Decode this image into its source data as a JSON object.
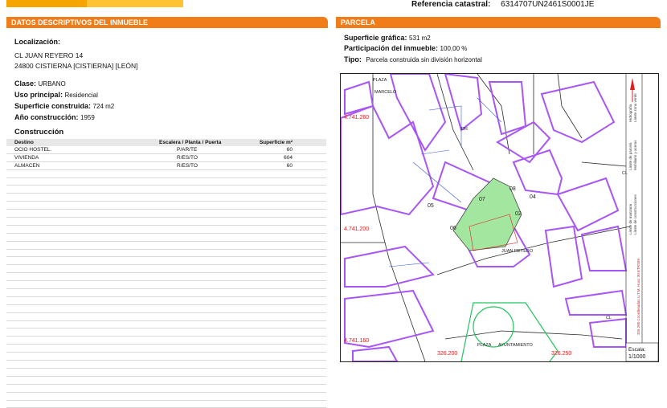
{
  "header": {
    "ref_label": "Referencia catastral:",
    "ref_value": "6314707UN2461S0001JE"
  },
  "left": {
    "title": "DATOS DESCRIPTIVOS DEL INMUEBLE",
    "localizacion_label": "Localización:",
    "address_line1": "CL JUAN REYERO 14",
    "address_line2": "24800 CISTIERNA [CISTIERNA] [LEÓN]",
    "clase_label": "Clase:",
    "clase_value": "URBANO",
    "uso_label": "Uso principal:",
    "uso_value": "Residencial",
    "sup_label": "Superficie construida:",
    "sup_value": "724 m2",
    "anio_label": "Año construcción:",
    "anio_value": "1959",
    "construccion_title": "Construcción",
    "table_headers": [
      "Destino",
      "Escalera / Planta / Puerta",
      "Superficie m²"
    ],
    "rows": [
      [
        "OCIO HOSTEL.",
        "P/AR/TE",
        "60"
      ],
      [
        "VIVIENDA",
        "R/ES/TO",
        "604"
      ],
      [
        "ALMACEN",
        "R/ES/TO",
        "60"
      ]
    ]
  },
  "right": {
    "title": "PARCELA",
    "sup_grafica_label": "Superficie gráfica:",
    "sup_grafica_value": "531 m2",
    "participacion_label": "Participación del inmueble:",
    "participacion_value": "100,00 %",
    "tipo_label": "Tipo:",
    "tipo_value": "Parcela construida sin división horizontal"
  },
  "map": {
    "street_labels": [
      "PLAZA",
      "MARCELO",
      "JUAN REYERO",
      "PLAZA",
      "AYUNTAMIENTO",
      "CL",
      "DR",
      "CL"
    ],
    "coord_labels": [
      "4.741.260",
      "4.741.200",
      "4.741.160",
      "326.200",
      "326.250"
    ],
    "parcel_labels": [
      "06",
      "05",
      "07",
      "08",
      "02",
      "04"
    ],
    "legend_items": [
      "Límite de manzana",
      "Límite de parcela",
      "Límite de construcciones",
      "Mobiliario y aceras",
      "Límite zona verde",
      "Hidrografía"
    ],
    "crs_text": "326.200 Coordenadas U.T.M. Huso 30 ETRS89",
    "scale_label": "Escala:",
    "scale_value": "1/1000",
    "colors": {
      "block": "#a855f7",
      "parcel": "#a3e6a0",
      "coord": "#e02020",
      "road": "#2a2a2a",
      "green": "#22c55e"
    }
  }
}
